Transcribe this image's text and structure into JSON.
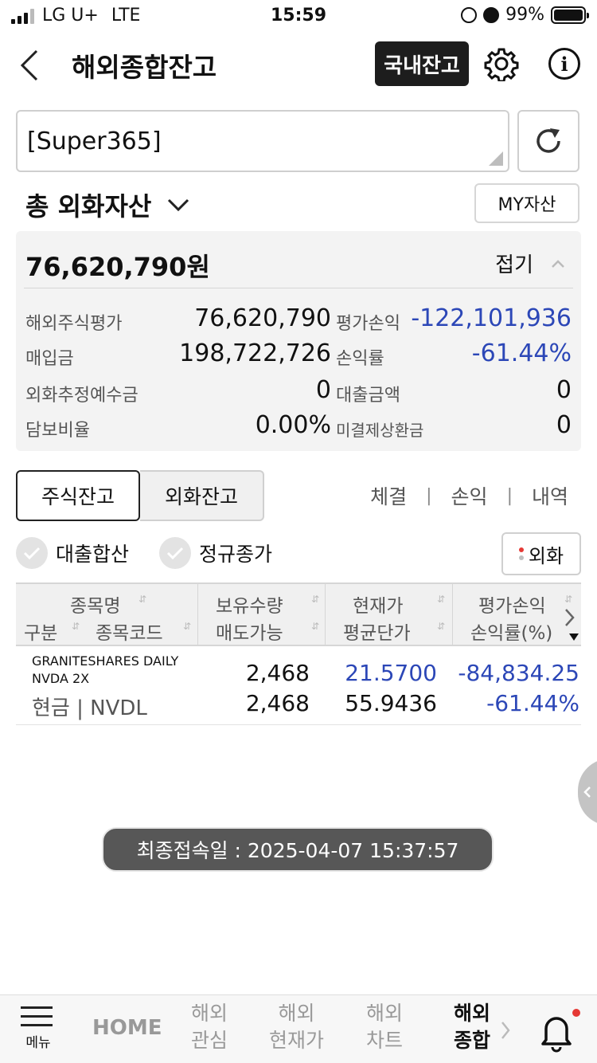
{
  "status_bar": {
    "carrier": "LG U+",
    "network": "LTE",
    "time": "15:59",
    "battery": "99%"
  },
  "header": {
    "title": "해외종합잔고",
    "domestic_button": "국내잔고"
  },
  "account": {
    "name": "[Super365]"
  },
  "assets": {
    "title": "총 외화자산",
    "my_assets_button": "MY자산",
    "total_amount": "76,620,790원",
    "fold_label": "접기",
    "rows": [
      {
        "label": "해외주식평가",
        "value": "76,620,790",
        "label2": "평가손익",
        "value2": "-122,101,936"
      },
      {
        "label": "매입금",
        "value": "198,722,726",
        "label2": "손익률",
        "value2": "-61.44%"
      },
      {
        "label": "외화추정예수금",
        "value": "0",
        "label2": "대출금액",
        "value2": "0"
      },
      {
        "label": "담보비율",
        "value": "0.00%",
        "label2": "미결제상환금",
        "value2": "0"
      }
    ]
  },
  "tabs": {
    "stock": "주식잔고",
    "fx": "외화잔고",
    "links": [
      "체결",
      "손익",
      "내역"
    ],
    "separator": "|"
  },
  "filters": {
    "loan_sum": "대출합산",
    "regular_close": "정규종가",
    "fx_button": "외화"
  },
  "table": {
    "headers": {
      "c1_top": "종목명",
      "c1_bottom_a": "구분",
      "c1_bottom_b": "종목코드",
      "c2_top": "보유수량",
      "c2_bottom": "매도가능",
      "c3_top": "현재가",
      "c3_bottom": "평균단가",
      "c4_top": "평가손익",
      "c4_bottom": "손익률(%)"
    },
    "rows": [
      {
        "name_line1": "GRANITESHARES DAILY",
        "name_line2": "NVDA 2X",
        "type_code": "현금 | NVDL",
        "qty": "2,468",
        "sellable": "2,468",
        "price": "21.5700",
        "avg_price": "55.9436",
        "pnl": "-84,834.25",
        "pnl_rate": "-61.44%"
      }
    ]
  },
  "toast": {
    "text": "최종접속일 : 2025-04-07 15:37:57"
  },
  "bottom_nav": {
    "menu": "메뉴",
    "home": "HOME",
    "items": [
      {
        "line1": "해외",
        "line2": "관심"
      },
      {
        "line1": "해외",
        "line2": "현재가"
      },
      {
        "line1": "해외",
        "line2": "차트"
      },
      {
        "line1": "해외",
        "line2": "종합"
      }
    ]
  },
  "colors": {
    "negative_blue": "#2c47b7",
    "dark_button": "#1d1d1d",
    "alert_red": "#e53935"
  }
}
